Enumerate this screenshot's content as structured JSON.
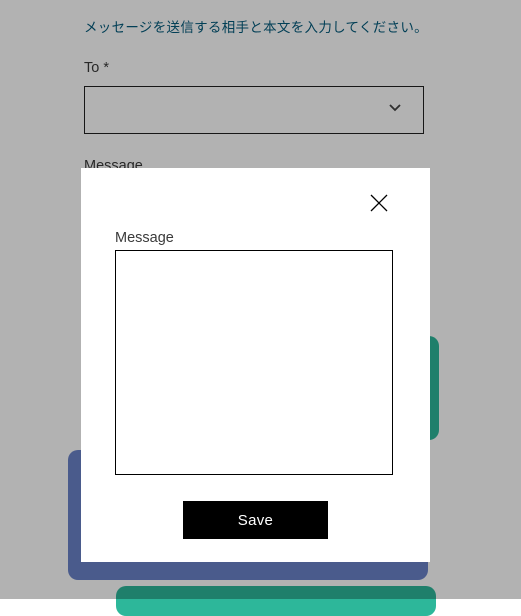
{
  "form": {
    "instruction": "メッセージを送信する相手と本文を入力してください。",
    "to_label": "To *",
    "message_label": "Message"
  },
  "modal": {
    "message_label": "Message",
    "textarea_value": "",
    "save_label": "Save"
  }
}
